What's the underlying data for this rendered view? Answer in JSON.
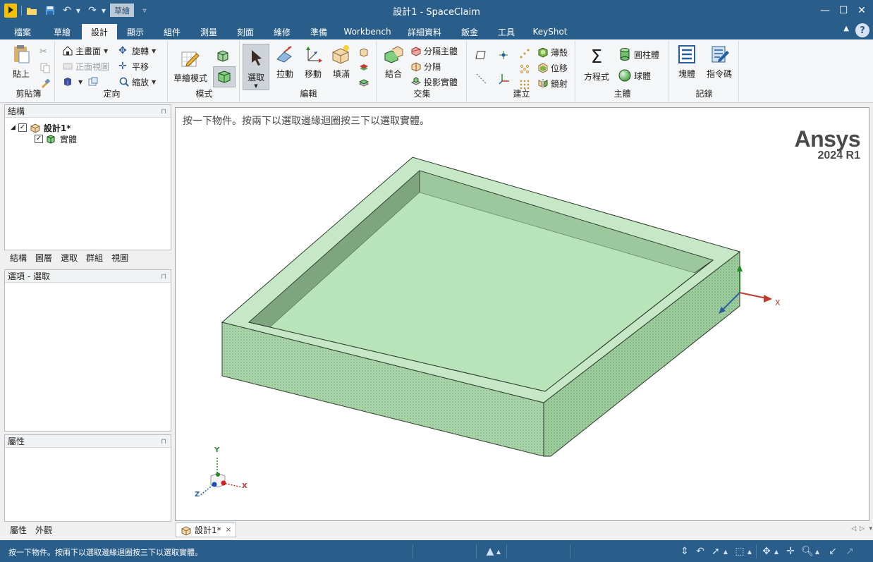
{
  "window": {
    "title": "設計1 - SpaceClaim",
    "mode_chip": "草繪",
    "minimize": "—",
    "maximize": "☐",
    "close": "✕"
  },
  "tabs": [
    {
      "label": "檔案"
    },
    {
      "label": "草繪"
    },
    {
      "label": "設計"
    },
    {
      "label": "顯示"
    },
    {
      "label": "組件"
    },
    {
      "label": "測量"
    },
    {
      "label": "刻面"
    },
    {
      "label": "維修"
    },
    {
      "label": "準備"
    },
    {
      "label": "Workbench"
    },
    {
      "label": "詳細資料"
    },
    {
      "label": "鈑金"
    },
    {
      "label": "工具"
    },
    {
      "label": "KeyShot"
    }
  ],
  "active_tab": "設計",
  "help_label": "?",
  "ribbon": {
    "clipboard": {
      "label": "剪貼簿",
      "paste": "貼上"
    },
    "orient": {
      "label": "定向",
      "home": "主畫面",
      "plan_view": "正面視圖",
      "spin": "旋轉",
      "pan": "平移",
      "zoom": "縮放"
    },
    "mode": {
      "label": "模式",
      "sketch_mode": "草繪模式"
    },
    "edit": {
      "label": "編輯",
      "select": "選取",
      "pull": "拉動",
      "move": "移動",
      "fill": "填滿"
    },
    "intersect": {
      "label": "交集",
      "combine": "結合",
      "split_body": "分隔主體",
      "split": "分隔",
      "project": "投影實體"
    },
    "create": {
      "label": "建立",
      "shell": "薄殼",
      "offset": "位移",
      "mirror": "鏡射"
    },
    "body": {
      "label": "主體",
      "equation": "方程式",
      "cylinder": "圓柱體",
      "sphere": "球體"
    },
    "record": {
      "label": "記錄",
      "block": "塊體",
      "script": "指令碼"
    }
  },
  "structure_panel": {
    "title": "結構",
    "root": "設計1*",
    "child": "實體",
    "tabs": [
      "結構",
      "圖層",
      "選取",
      "群組",
      "視圖"
    ]
  },
  "options_panel": {
    "title": "選項 - 選取"
  },
  "properties_panel": {
    "title": "屬性",
    "tabs": [
      "屬性",
      "外觀"
    ]
  },
  "viewport": {
    "hint": "按一下物件。按兩下以選取邊緣迴圈按三下以選取實體。",
    "brand_name": "Ansys",
    "brand_version": "2024 R1",
    "axis_x": "X",
    "axis_y": "Y",
    "axis_z": "Z"
  },
  "doc_tab": {
    "label": "設計1*",
    "close": "×"
  },
  "status": {
    "text": "按一下物件。按兩下以選取邊緣迴圈按三下以選取實體。"
  },
  "colors": {
    "chrome": "#295d8a",
    "body_top": "#c7e8c7",
    "body_side": "#a7d3a7",
    "inner": "#b6e1b6"
  }
}
